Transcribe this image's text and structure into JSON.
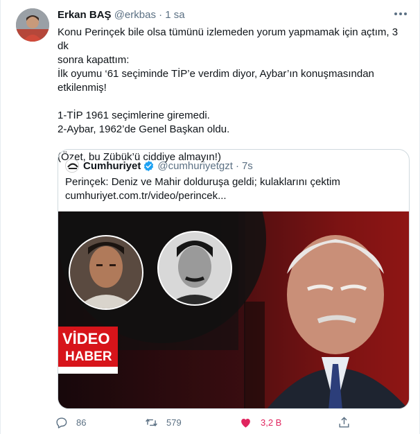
{
  "tweet": {
    "author_name": "Erkan BAŞ",
    "author_handle": "@erkbas",
    "separator": "·",
    "time": "1 sa",
    "lines": [
      "Konu Perinçek bile olsa tümünü izlemeden yorum yapmamak için açtım, 3 dk",
      "sonra kapattım:",
      "İlk oyumu ‘61 seçiminde TİP’e verdim diyor, Aybar’ın konuşmasından",
      "etkilenmiş!",
      "",
      "1-TİP 1961 seçimlerine giremedi.",
      "2-Aybar, 1962’de Genel Başkan oldu.",
      "",
      "(Özet, bu Zübük’ü ciddiye almayın!)"
    ]
  },
  "quote": {
    "author_name": "Cumhuriyet",
    "author_handle": "@cumhuriyetgzt",
    "separator": "·",
    "time": "7s",
    "text": "Perinçek: Deniz ve Mahir dolduruşa geldi; kulaklarını çektim",
    "link": "cumhuriyet.com.tr/video/perincek...",
    "media": {
      "badge_line1": "VİDEO",
      "badge_line2": "HABER"
    }
  },
  "actions": {
    "replies": "86",
    "retweets": "579",
    "likes": "3,2 B",
    "like_color": "#e0245e",
    "icon_color": "#5b7083"
  },
  "colors": {
    "text": "#0f1419",
    "secondary": "#5b7083",
    "verified": "#1da1f2",
    "badge_red": "#d7141a"
  }
}
